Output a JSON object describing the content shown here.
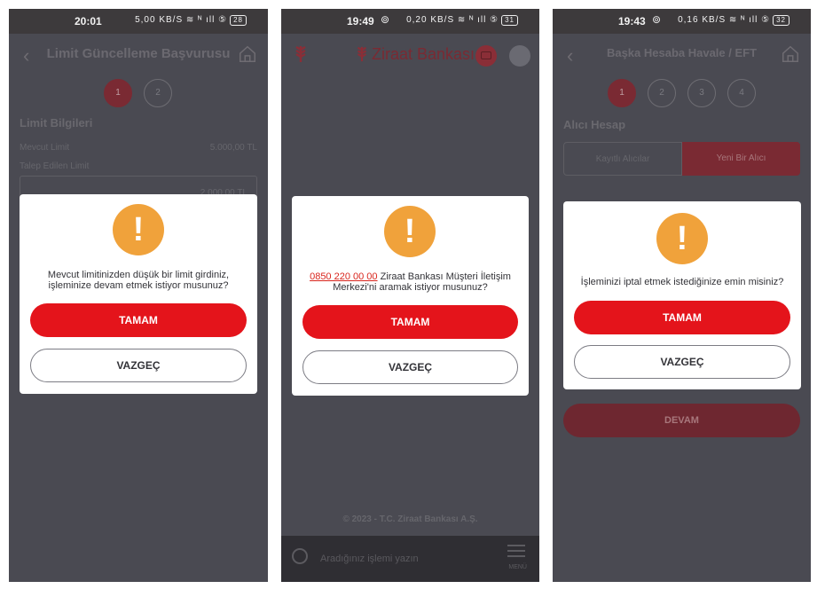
{
  "screens": [
    {
      "status": {
        "time": "20:01",
        "signal": "5,00 KB/S ≋ ᴺ ıll ⑤",
        "battery": "28"
      },
      "header": {
        "title": "Limit Güncelleme Başvurusu"
      },
      "steps": [
        "1",
        "2"
      ],
      "background": {
        "section_title": "Limit Bilgileri",
        "current_limit_label": "Mevcut Limit",
        "current_limit_value": "5.000,00 TL",
        "requested_limit_label": "Talep Edilen Limit",
        "requested_limit_value": "2.000,00 TL"
      },
      "dialog": {
        "icon": "!",
        "message": "Mevcut limitinizden düşük bir limit girdiniz, işleminize devam etmek istiyor musunuz?",
        "ok_label": "TAMAM",
        "cancel_label": "VAZGEÇ"
      }
    },
    {
      "status": {
        "time": "19:49",
        "camera": "⊚",
        "signal": "0,20 KB/S ≋ ᴺ ıll ⑤",
        "battery": "31"
      },
      "header": {
        "brand": "Ziraat Bankası"
      },
      "dialog": {
        "icon": "!",
        "phone_number": "0850 220 00 00",
        "message": " Ziraat Bankası Müşteri İletişim Merkezi'ni aramak istiyor musunuz?",
        "ok_label": "TAMAM",
        "cancel_label": "VAZGEÇ"
      },
      "footer": {
        "copyright": "© 2023 - T.C. Ziraat Bankası A.Ş.",
        "search_placeholder": "Aradığınız işlemi yazın",
        "menu_label": "MENÜ"
      }
    },
    {
      "status": {
        "time": "19:43",
        "camera": "⊚",
        "signal": "0,16 KB/S ≋ ᴺ ıll ⑤",
        "battery": "32"
      },
      "header": {
        "title": "Başka Hesaba Havale / EFT"
      },
      "steps": [
        "1",
        "2",
        "3",
        "4"
      ],
      "background": {
        "section_title": "Alıcı Hesap",
        "tab_saved": "Kayıtlı Alıcılar",
        "tab_new": "Yeni Bir Alıcı",
        "continue_label": "DEVAM"
      },
      "dialog": {
        "icon": "!",
        "message": "İşleminizi iptal etmek istediğinize emin misiniz?",
        "ok_label": "TAMAM",
        "cancel_label": "VAZGEÇ"
      }
    }
  ],
  "colors": {
    "primary_red": "#e4141b",
    "warning_orange": "#f0a23b",
    "dim_overlay": "#4a4a52",
    "status_bar": "#3d3a3c"
  },
  "icons": [
    "back-arrow-icon",
    "home-icon",
    "warning-icon",
    "wheat-logo-icon",
    "chat-icon",
    "search-icon",
    "menu-icon"
  ]
}
